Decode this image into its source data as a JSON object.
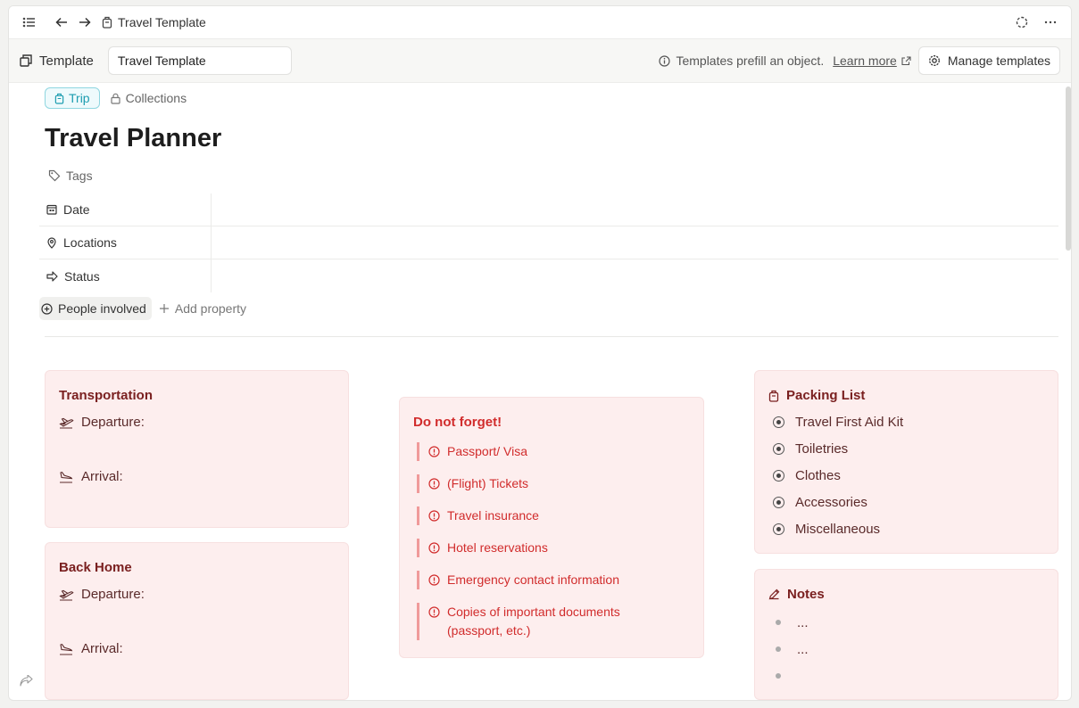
{
  "topbar": {
    "title": "Travel Template"
  },
  "template_bar": {
    "label": "Template",
    "input_value": "Travel Template",
    "info_text": "Templates prefill an object.",
    "learn_more": "Learn more",
    "manage_button": "Manage templates"
  },
  "crumbs": {
    "type_label": "Trip",
    "collections_label": "Collections"
  },
  "page": {
    "title": "Travel Planner",
    "tags_label": "Tags"
  },
  "properties": [
    {
      "key": "Date",
      "icon": "calendar-icon"
    },
    {
      "key": "Locations",
      "icon": "map-pin-icon"
    },
    {
      "key": "Status",
      "icon": "arrow-right-icon"
    }
  ],
  "people_involved": "People involved",
  "add_property": "Add property",
  "transportation": {
    "title": "Transportation",
    "departure": "Departure:",
    "arrival": "Arrival:"
  },
  "back_home": {
    "title": "Back Home",
    "departure": "Departure:",
    "arrival": "Arrival:"
  },
  "do_not_forget": {
    "title": "Do not forget!",
    "items": [
      "Passport/ Visa",
      "(Flight) Tickets",
      "Travel insurance",
      "Hotel reservations",
      "Emergency contact information",
      "Copies of important documents (passport, etc.)"
    ]
  },
  "packing_list": {
    "title": "Packing List",
    "items": [
      "Travel First Aid Kit",
      "Toiletries",
      "Clothes",
      "Accessories",
      "Miscellaneous"
    ]
  },
  "notes": {
    "title": "Notes",
    "items": [
      "...",
      "...",
      ""
    ]
  },
  "colors": {
    "accent_card": "#fdeeee",
    "forget_red": "#d12c2c",
    "trip_teal": "#1d9db0"
  }
}
